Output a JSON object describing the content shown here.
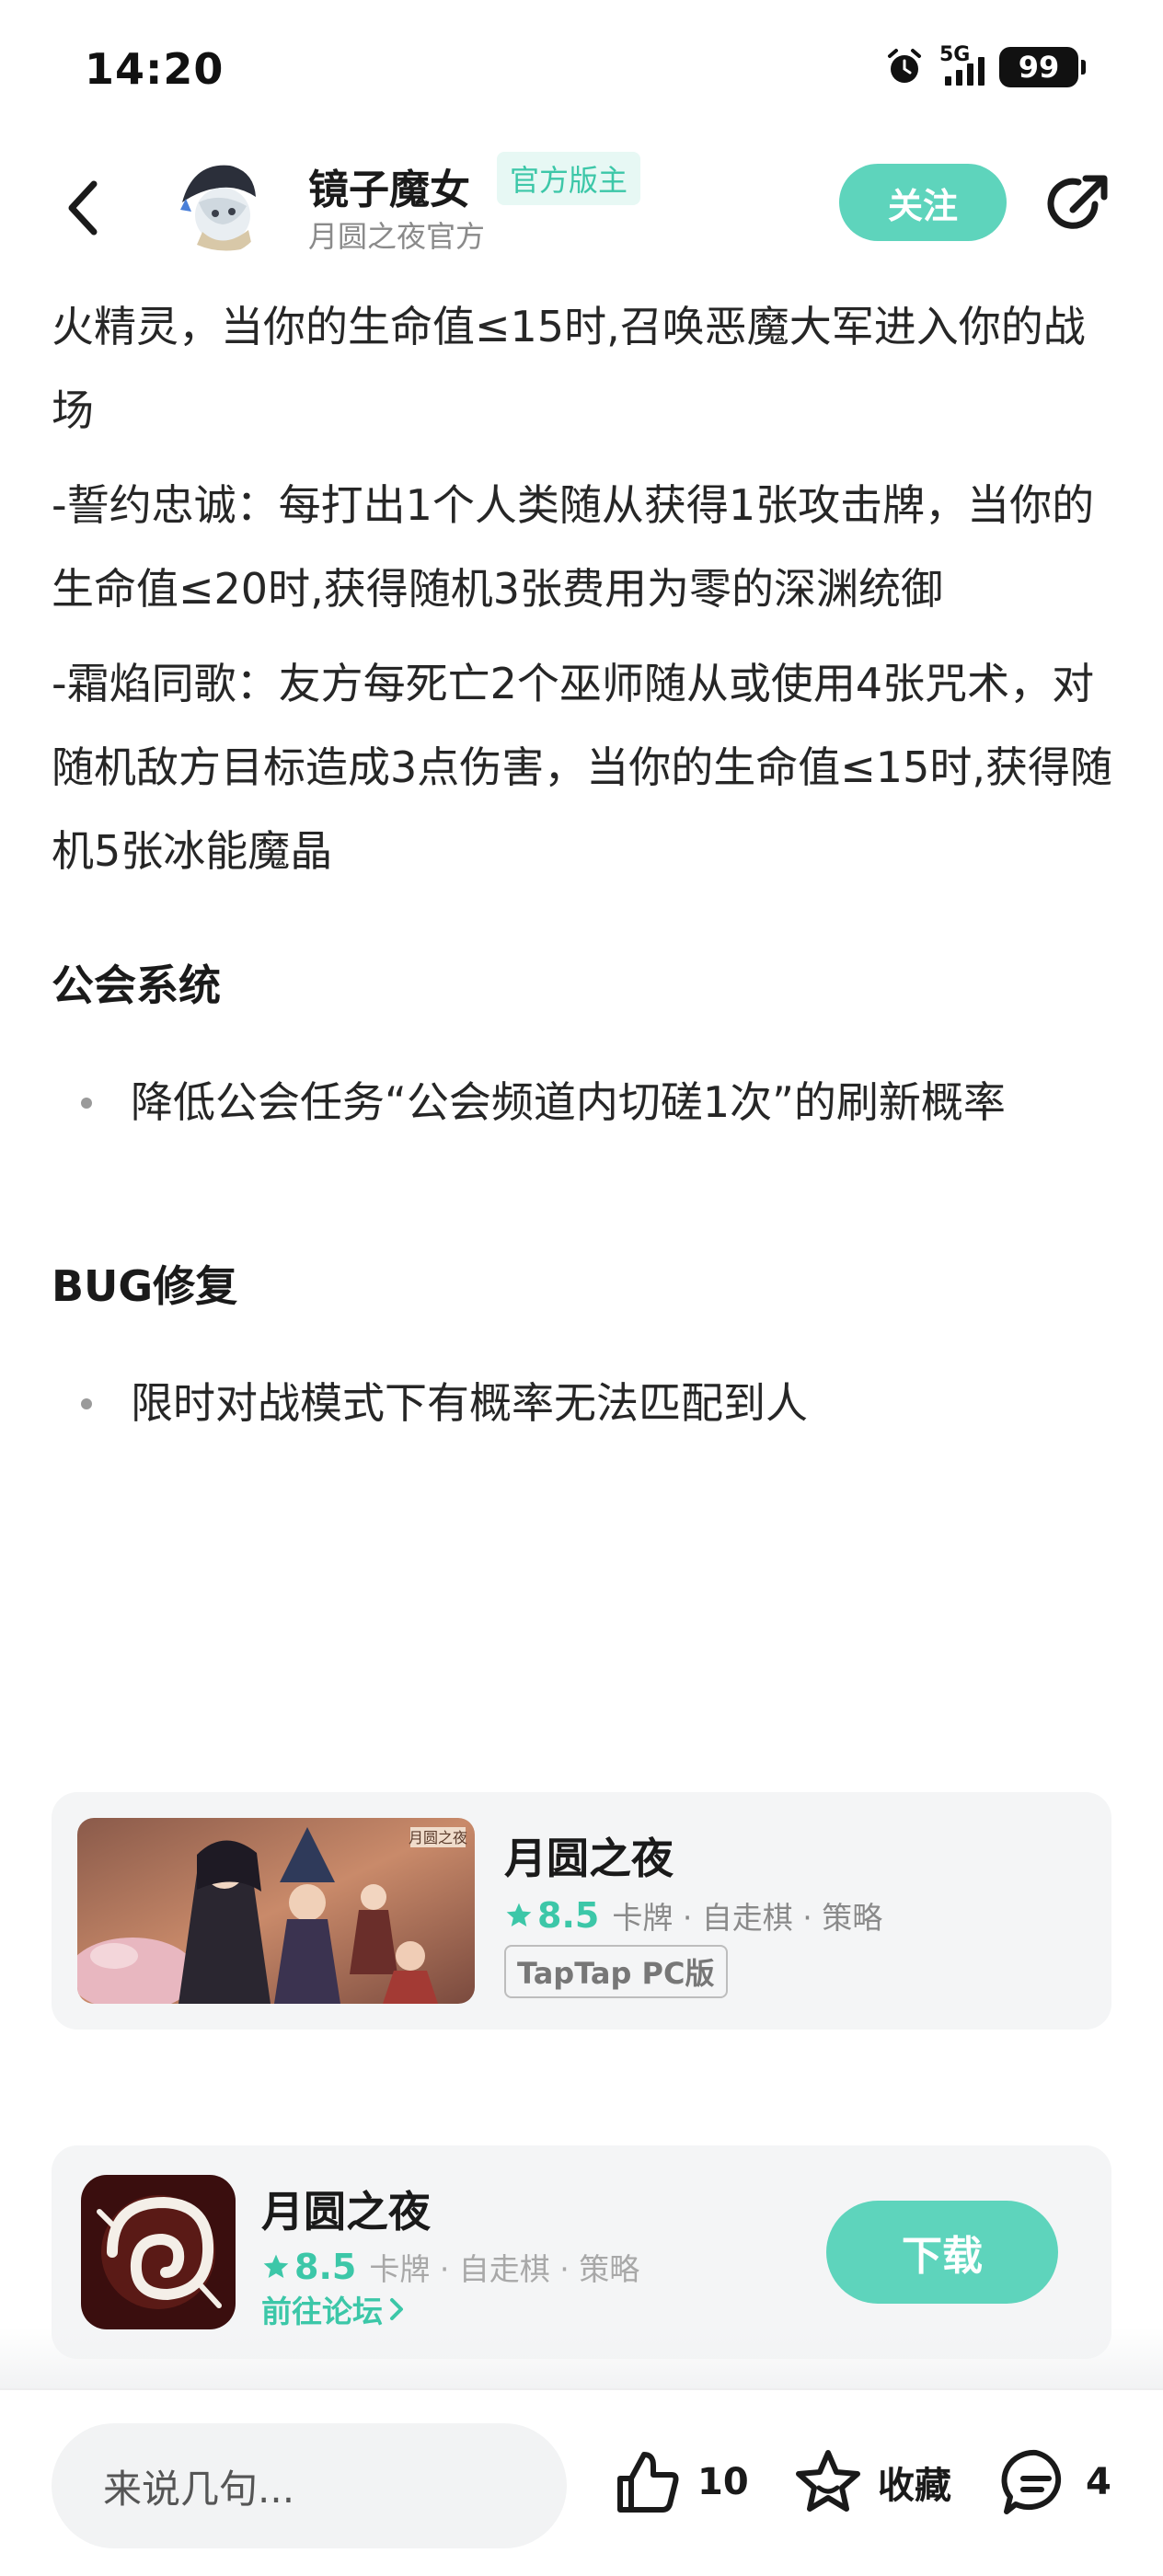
{
  "status_bar": {
    "time": "14:20",
    "network": "5G",
    "battery": "99",
    "icons": [
      "alarm-icon",
      "signal-icon",
      "battery-icon"
    ]
  },
  "header": {
    "back_icon": "chevron-left-icon",
    "author_name": "镜子魔女",
    "author_badge": "官方版主",
    "author_subtitle": "月圆之夜官方",
    "follow_label": "关注",
    "share_icon": "share-icon"
  },
  "article": {
    "paragraphs": [
      "火精灵，当你的生命值≤15时,召唤恶魔大军进入你的战场",
      "-誓约忠诚：每打出1个人类随从获得1张攻击牌，当你的生命值≤20时,获得随机3张费用为零的深渊统御",
      "-霜焰同歌：友方每死亡2个巫师随从或使用4张咒术，对随机敌方目标造成3点伤害，当你的生命值≤15时,获得随机5张冰能魔晶"
    ],
    "sections": [
      {
        "title": "公会系统",
        "items": [
          "降低公会任务“公会频道内切磋1次”的刷新概率"
        ]
      },
      {
        "title": "BUG修复",
        "items": [
          "限时对战模式下有概率无法匹配到人"
        ]
      }
    ]
  },
  "game_card": {
    "name": "月圆之夜",
    "rating": "8.5",
    "tags": "卡牌 · 自走棋 · 策略",
    "pc_tag": "TapTap PC版",
    "cover_logo": "月圆之夜"
  },
  "promo_card": {
    "name": "月圆之夜",
    "rating": "8.5",
    "tags": "卡牌 · 自走棋 · 策略",
    "forum_link": "前往论坛",
    "download_label": "下载"
  },
  "bottom_bar": {
    "comment_placeholder": "来说几句...",
    "like_count": "10",
    "favorite_label": "收藏",
    "comment_count": "4"
  },
  "colors": {
    "accent": "#5ed4bc",
    "accent_text": "#3cc7a8",
    "card_bg": "#f4f5f6"
  }
}
